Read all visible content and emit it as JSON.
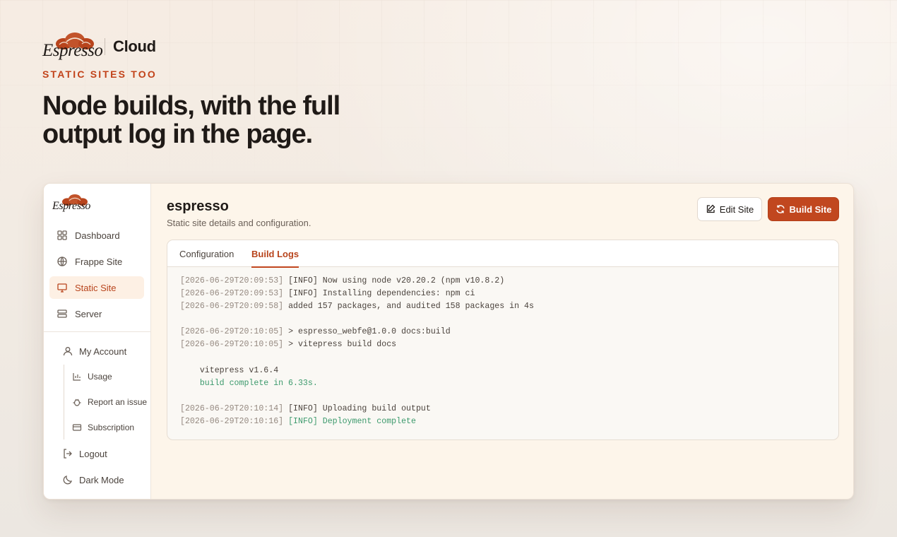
{
  "hero": {
    "brand_word": "Espresso",
    "brand_product": "Cloud",
    "eyebrow": "STATIC SITES TOO",
    "headline_line1": "Node builds, with the full",
    "headline_line2": "output log in the page."
  },
  "colors": {
    "accent": "#c1471f",
    "success": "#3d9a6d",
    "active_bg": "#fdf0e4"
  },
  "sidebar": {
    "logo_word": "Espresso",
    "items": [
      {
        "label": "Dashboard",
        "icon": "grid-icon",
        "active": false
      },
      {
        "label": "Frappe Site",
        "icon": "globe-icon",
        "active": false
      },
      {
        "label": "Static Site",
        "icon": "monitor-icon",
        "active": true
      },
      {
        "label": "Server",
        "icon": "server-icon",
        "active": false
      }
    ],
    "account": {
      "label": "My Account",
      "icon": "user-icon",
      "children": [
        {
          "label": "Usage",
          "icon": "chart-icon"
        },
        {
          "label": "Report an issue",
          "icon": "bug-icon"
        },
        {
          "label": "Subscription",
          "icon": "credit-card-icon"
        }
      ]
    },
    "logout": {
      "label": "Logout",
      "icon": "logout-icon"
    },
    "dark_mode": {
      "label": "Dark Mode",
      "icon": "moon-icon"
    }
  },
  "main": {
    "title": "espresso",
    "subtitle": "Static site details and configuration.",
    "edit_button": "Edit Site",
    "build_button": "Build Site",
    "tabs": [
      {
        "label": "Configuration",
        "active": false
      },
      {
        "label": "Build Logs",
        "active": true
      }
    ],
    "log": [
      {
        "ts": "[2026-06-29T20:09:53]",
        "msg": " [INFO] Now using node v20.20.2 (npm v10.8.2)",
        "ok": false
      },
      {
        "ts": "[2026-06-29T20:09:53]",
        "msg": " [INFO] Installing dependencies: npm ci",
        "ok": false
      },
      {
        "ts": "[2026-06-29T20:09:58]",
        "msg": " added 157 packages, and audited 158 packages in 4s",
        "ok": false
      },
      {
        "ts": "",
        "msg": "",
        "ok": false
      },
      {
        "ts": "[2026-06-29T20:10:05]",
        "msg": " > espresso_webfe@1.0.0 docs:build",
        "ok": false
      },
      {
        "ts": "[2026-06-29T20:10:05]",
        "msg": " > vitepress build docs",
        "ok": false
      },
      {
        "ts": "",
        "msg": "",
        "ok": false
      },
      {
        "ts": "",
        "msg": "    vitepress v1.6.4",
        "ok": false
      },
      {
        "ts": "",
        "msg": "    build complete in 6.33s.",
        "ok": true
      },
      {
        "ts": "",
        "msg": "",
        "ok": false
      },
      {
        "ts": "[2026-06-29T20:10:14]",
        "msg": " [INFO] Uploading build output",
        "ok": false
      },
      {
        "ts": "[2026-06-29T20:10:16]",
        "msg": " [INFO] Deployment complete",
        "ok": true
      }
    ]
  }
}
